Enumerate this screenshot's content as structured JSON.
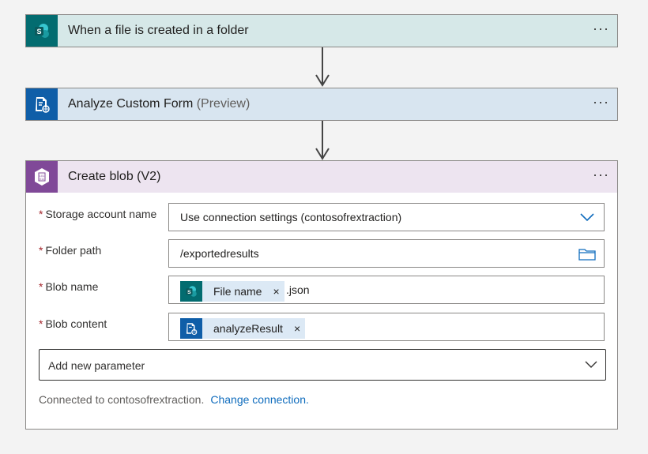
{
  "steps": {
    "trigger": {
      "title": "When a file is created in a folder",
      "icon": "sharepoint-icon",
      "color": "#036c70",
      "header_bg": "#d6e8e8",
      "more": "···"
    },
    "analyze": {
      "title": "Analyze Custom Form",
      "suffix": "(Preview)",
      "icon": "form-recognizer-icon",
      "color": "#0f5ea8",
      "header_bg": "#d8e5f0",
      "more": "···"
    },
    "blob": {
      "title": "Create blob (V2)",
      "icon": "blob-storage-icon",
      "color": "#804998",
      "header_bg": "#ede4f0",
      "more": "···"
    }
  },
  "form": {
    "required_mark": "*",
    "storage_account": {
      "label": "Storage account name",
      "value": "Use connection settings (contosofrextraction)"
    },
    "folder_path": {
      "label": "Folder path",
      "value": "/exportedresults"
    },
    "blob_name": {
      "label": "Blob name",
      "token": "File name",
      "token_close": "×",
      "suffix": ".json"
    },
    "blob_content": {
      "label": "Blob content",
      "token": "analyzeResult",
      "token_close": "×"
    },
    "add_parameter": "Add new parameter",
    "connected_text": "Connected to contosofrextraction.",
    "change_connection": "Change connection."
  }
}
